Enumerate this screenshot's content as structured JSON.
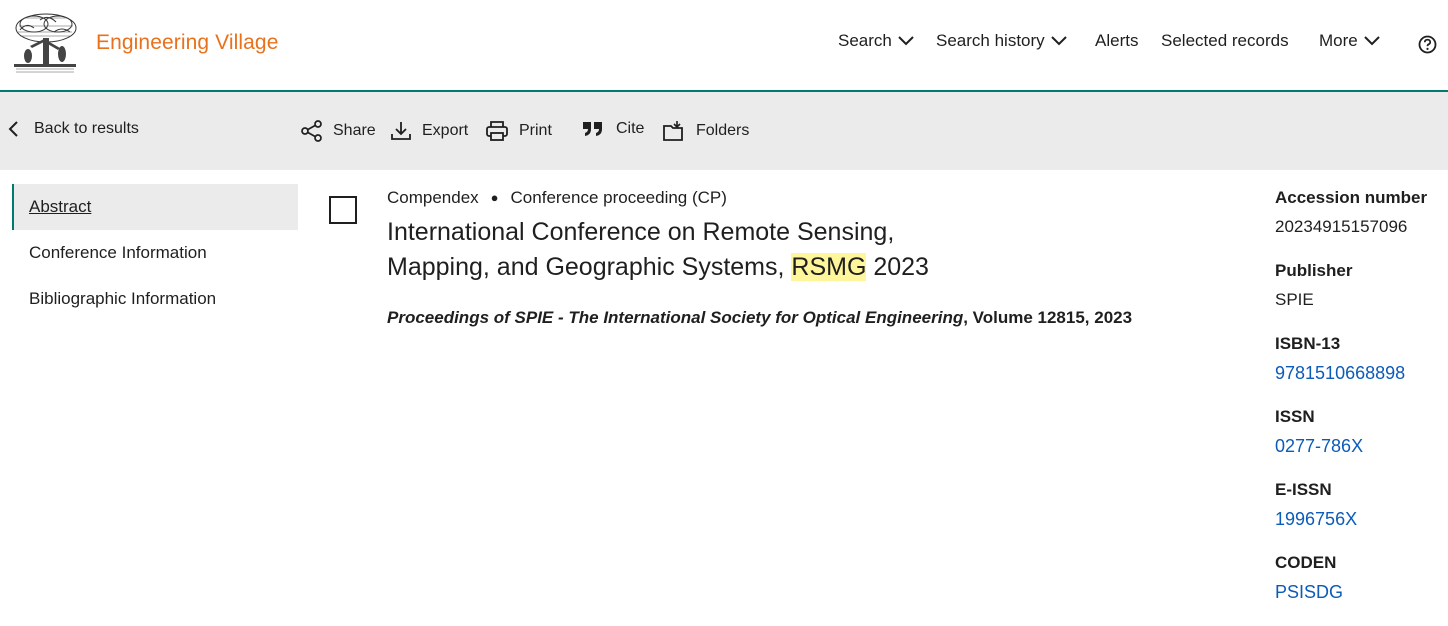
{
  "brand": {
    "name": "Engineering Village",
    "logo_icon": "elsevier-tree-icon"
  },
  "topnav": {
    "search": "Search",
    "search_history": "Search history",
    "alerts": "Alerts",
    "selected_records": "Selected records",
    "more": "More",
    "help_icon": "help-icon"
  },
  "toolbar": {
    "back": "Back to results",
    "share": "Share",
    "export": "Export",
    "print": "Print",
    "cite": "Cite",
    "folders": "Folders"
  },
  "sidenav": {
    "items": [
      {
        "label": "Abstract",
        "active": true
      },
      {
        "label": "Conference Information",
        "active": false
      },
      {
        "label": "Bibliographic Information",
        "active": false
      }
    ]
  },
  "record": {
    "database": "Compendex",
    "doc_type": "Conference proceeding (CP)",
    "title_before": "International Conference on Remote Sensing, Mapping, and Geographic Systems, ",
    "title_highlight": "RSMG",
    "title_after": " 2023",
    "source_title": "Proceedings of SPIE - The International Society for Optical Engineering",
    "source_rest": ", Volume 12815, 2023"
  },
  "details": {
    "accession_label": "Accession number",
    "accession_value": "20234915157096",
    "publisher_label": "Publisher",
    "publisher_value": "SPIE",
    "isbn_label": "ISBN-13",
    "isbn_value": "9781510668898",
    "issn_label": "ISSN",
    "issn_value": "0277-786X",
    "eissn_label": "E-ISSN",
    "eissn_value": "1996756X",
    "coden_label": "CODEN",
    "coden_value": "PSISDG"
  },
  "colors": {
    "brand": "#e9711c",
    "accent": "#007a6e",
    "link": "#0c5bb8",
    "highlight": "#fff59a",
    "toolbar_bg": "#ebebeb"
  }
}
